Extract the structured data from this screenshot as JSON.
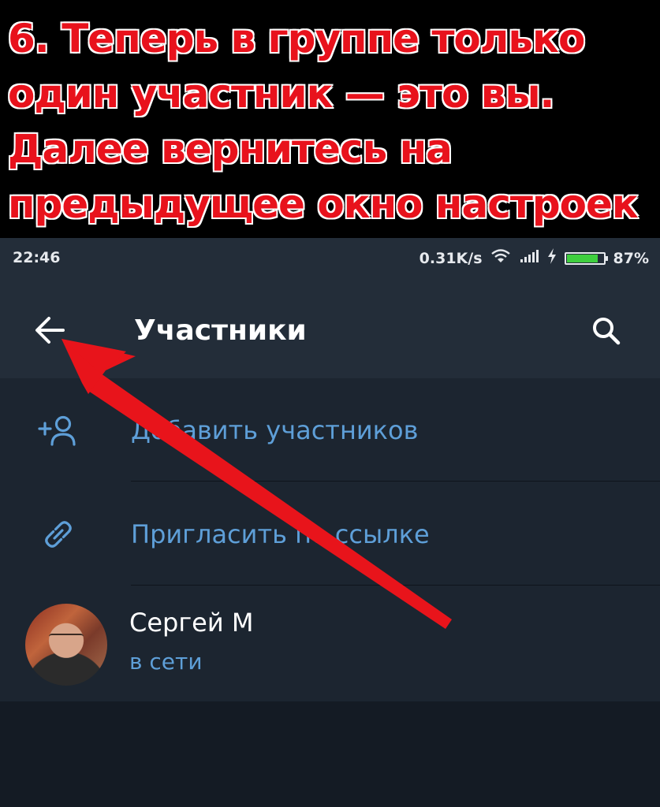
{
  "banner": {
    "text": "6. Теперь в группе только\nодин участник — это вы.\nДалее вернитесь на\nпредыдущее окно настроек"
  },
  "status_bar": {
    "time": "22:46",
    "network_speed": "0.31K/s",
    "battery_percent": "87%",
    "battery_level": 0.87
  },
  "app_bar": {
    "title": "Участники",
    "back_icon": "arrow-left-icon",
    "search_icon": "search-icon"
  },
  "actions": [
    {
      "label": "Добавить участников",
      "icon": "add-user-icon"
    },
    {
      "label": "Пригласить по ссылке",
      "icon": "link-icon"
    }
  ],
  "member": {
    "name": "Сергей М",
    "status": "в сети"
  },
  "colors": {
    "banner_text": "#e8121c",
    "accent": "#5e9fd8",
    "header_bg": "#232d39",
    "list_bg": "#1c2530",
    "annotation_arrow": "#e8141b"
  }
}
